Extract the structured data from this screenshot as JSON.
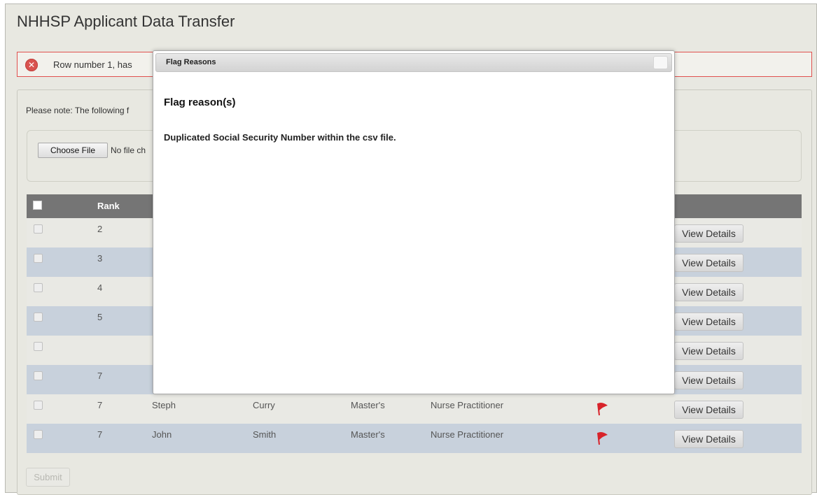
{
  "page": {
    "title": "NHHSP Applicant Data Transfer"
  },
  "error": {
    "icon": "error-x-icon",
    "message": "Row number 1, has"
  },
  "notice": {
    "text": "Please note: The following f"
  },
  "upload": {
    "button_label": "Choose File",
    "status": "No file ch"
  },
  "table": {
    "columns": {
      "rank": "Rank"
    },
    "rows": [
      {
        "rank": "2",
        "first": "",
        "last": "",
        "degree": "",
        "profession": "",
        "flagged": false,
        "action": "View Details"
      },
      {
        "rank": "3",
        "first": "",
        "last": "",
        "degree": "",
        "profession": "",
        "flagged": false,
        "action": "View Details"
      },
      {
        "rank": "4",
        "first": "",
        "last": "",
        "degree": "",
        "profession": "",
        "flagged": false,
        "action": "View Details"
      },
      {
        "rank": "5",
        "first": "",
        "last": "",
        "degree": "",
        "profession": "",
        "flagged": false,
        "action": "View Details"
      },
      {
        "rank": "",
        "first": "",
        "last": "",
        "degree": "",
        "profession": "",
        "flagged": false,
        "action": "View Details"
      },
      {
        "rank": "7",
        "first": "",
        "last": "",
        "degree": "",
        "profession": "",
        "flagged": false,
        "action": "View Details"
      },
      {
        "rank": "7",
        "first": "Steph",
        "last": "Curry",
        "degree": "Master's",
        "profession": "Nurse Practitioner",
        "flagged": true,
        "action": "View Details"
      },
      {
        "rank": "7",
        "first": "John",
        "last": "Smith",
        "degree": "Master's",
        "profession": "Nurse Practitioner",
        "flagged": true,
        "action": "View Details"
      }
    ]
  },
  "submit": {
    "label": "Submit"
  },
  "modal": {
    "title": "Flag Reasons",
    "heading": "Flag reason(s)",
    "body": "Duplicated Social Security Number within the csv file."
  },
  "colors": {
    "error_border": "#e0504e",
    "header_bg": "#757575",
    "row_alt": "#c8d1dc",
    "flag": "#d8232a"
  }
}
